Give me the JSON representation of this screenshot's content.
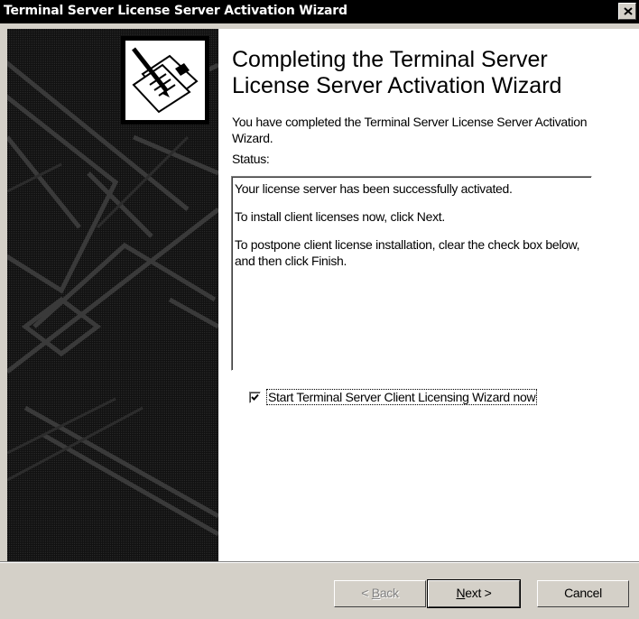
{
  "window": {
    "title": "Terminal Server License Server Activation Wizard"
  },
  "page": {
    "heading": "Completing the Terminal Server License Server Activation Wizard",
    "intro": "You have completed the Terminal Server License Server Activation Wizard.",
    "status_label": "Status:",
    "status_lines": [
      "Your license server has been successfully activated.",
      "To install client licenses now, click Next.",
      "To postpone client license installation, clear the check box below, and then click Finish."
    ],
    "checkbox": {
      "label": "Start Terminal Server Client Licensing Wizard now",
      "checked": true
    }
  },
  "buttons": {
    "back": {
      "prefix": "< ",
      "mnemonic": "B",
      "rest": "ack"
    },
    "next": {
      "mnemonic": "N",
      "rest": "ext >"
    },
    "cancel": "Cancel"
  },
  "icons": {
    "close": "close-icon",
    "wizard": "document-pen-icon",
    "check": "checkmark-icon"
  }
}
